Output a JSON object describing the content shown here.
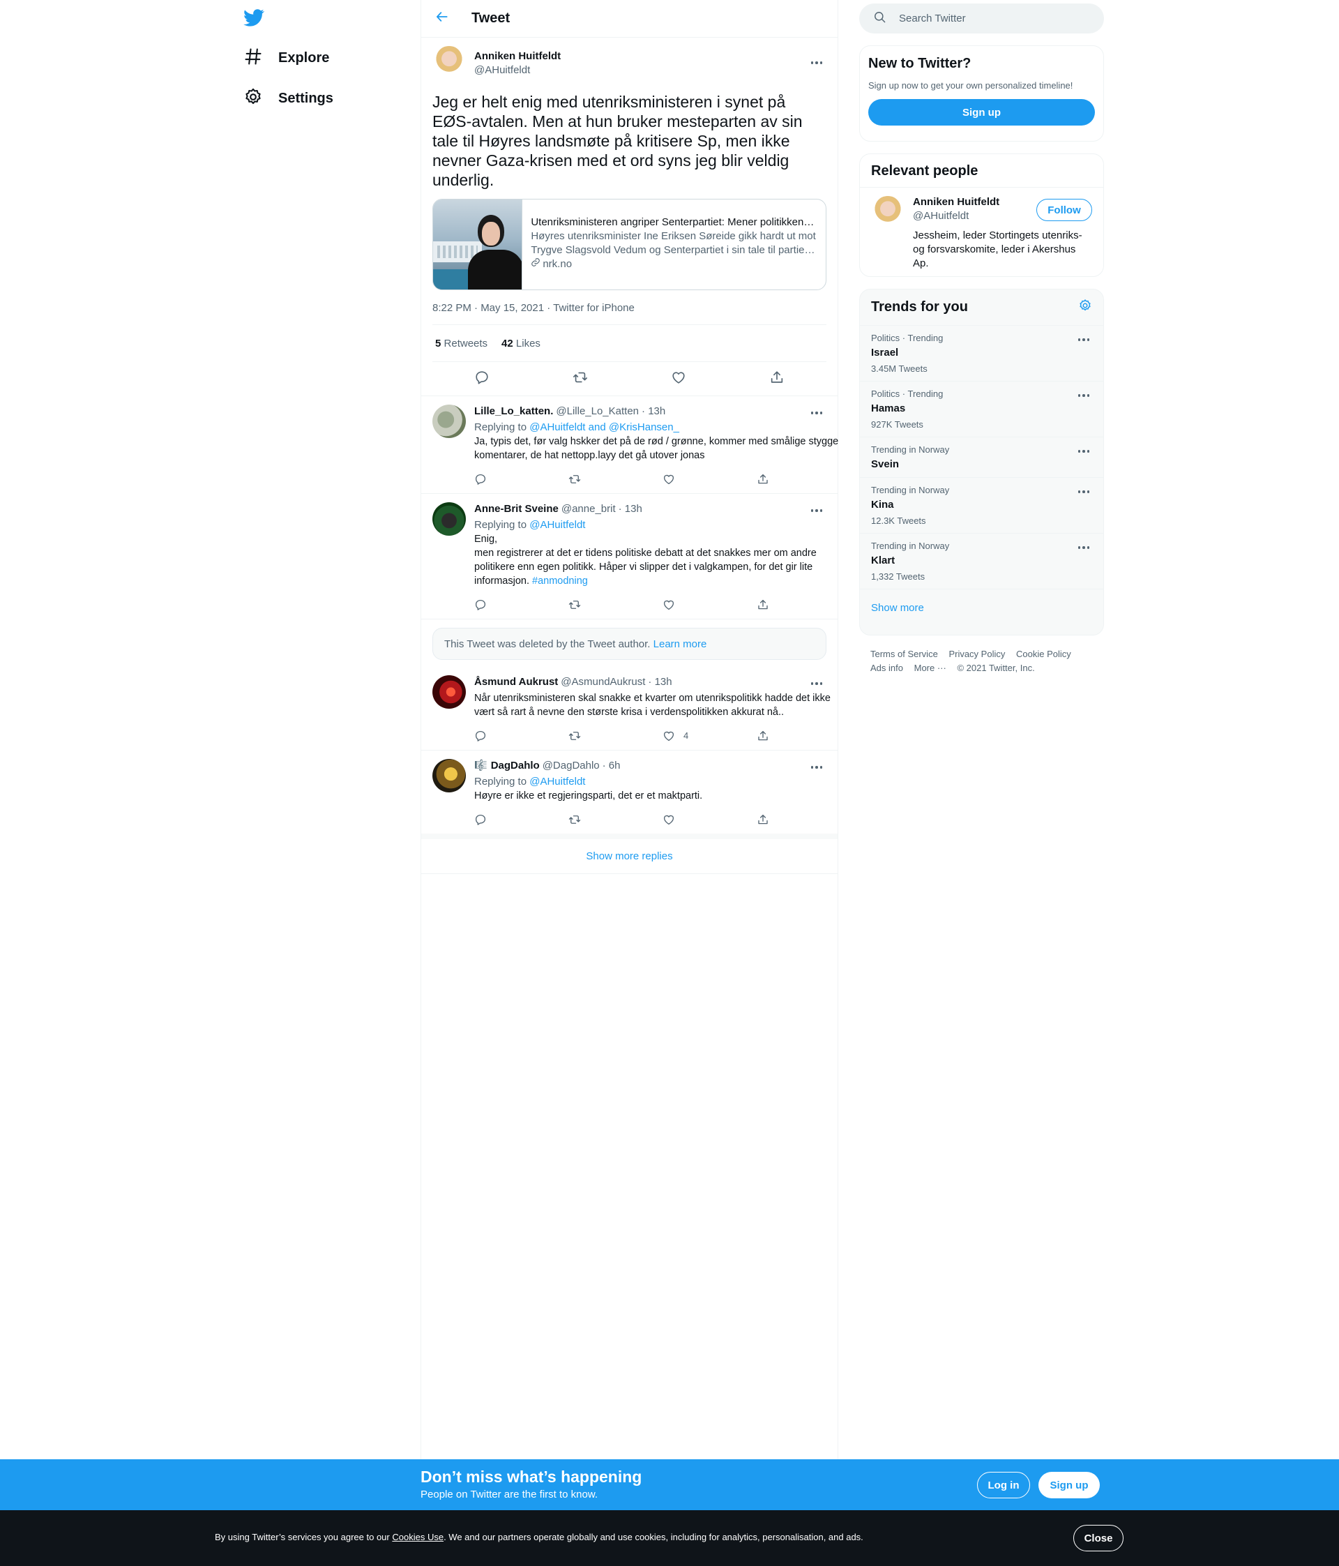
{
  "colors": {
    "accent": "#1d9bf0",
    "text": "#0f1419",
    "muted": "#536471",
    "border": "#eff3f4"
  },
  "nav": {
    "logo_icon": "twitter-bird-icon",
    "items": [
      {
        "label": "Explore",
        "icon": "hashtag-icon"
      },
      {
        "label": "Settings",
        "icon": "gear-icon"
      }
    ]
  },
  "header": {
    "title": "Tweet",
    "back_icon": "arrow-left-icon"
  },
  "tweet": {
    "author_name": "Anniken Huitfeldt",
    "author_handle": "@AHuitfeldt",
    "text": "Jeg er helt enig med utenriksministeren i synet på EØS-avtalen. Men at hun bruker mesteparten av sin tale til Høyres landsmøte på kritisere Sp, men ikke nevner Gaza-krisen med et ord syns jeg blir veldig underlig.",
    "card": {
      "title": "Utenriksministeren angriper Senterpartiet: Mener politikken…",
      "description": "Høyres utenriksminister Ine Eriksen Søreide gikk hardt ut mot Trygve Slagsvold Vedum og Senterpartiet i sin tale til partie…",
      "domain": "nrk.no"
    },
    "meta": "8:22 PM · May 15, 2021 · Twitter for iPhone",
    "retweets_count": "5",
    "retweets_label": "Retweets",
    "likes_count": "42",
    "likes_label": "Likes"
  },
  "replies": [
    {
      "name": "Lille_Lo_katten.",
      "handle": "@Lille_Lo_Katten",
      "time": "· 13h",
      "replying_prefix": "Replying to",
      "replying_to": "@AHuitfeldt and @KrisHansen_",
      "text": "Ja, typis det, før valg hskker det på de rød / grønne, kommer med smålige stygge komentarer, de hat nettopp.layy det gå utover jonas",
      "likes": ""
    },
    {
      "name": "Anne-Brit Sveine",
      "handle": "@anne_brit",
      "time": "· 13h",
      "replying_prefix": "Replying to",
      "replying_to": "@AHuitfeldt",
      "text_lines": [
        "Enig,",
        "men registrerer at det er tidens politiske debatt at det snakkes mer om andre politikere enn egen politikk. Håper vi slipper det i valgkampen, for det gir lite informasjon."
      ],
      "hashtag": "#anmodning",
      "likes": ""
    },
    {
      "name": "Åsmund Aukrust",
      "handle": "@AsmundAukrust",
      "time": "· 13h",
      "text": "Når utenriksministeren skal snakke et kvarter om utenrikspolitikk hadde det ikke vært så rart å nevne den største krisa i verdenspolitikken akkurat nå..",
      "likes": "4"
    },
    {
      "name": "DagDahlo",
      "name_prefix": "🎼",
      "handle": "@DagDahlo",
      "time": "· 6h",
      "replying_prefix": "Replying to",
      "replying_to": "@AHuitfeldt",
      "text": "Høyre er ikke et regjeringsparti, det er et maktparti.",
      "likes": ""
    }
  ],
  "deleted_notice": {
    "text": "This Tweet was deleted by the Tweet author.",
    "link": "Learn more"
  },
  "show_more_replies": "Show more replies",
  "search": {
    "placeholder": "Search Twitter"
  },
  "new_to_twitter": {
    "title": "New to Twitter?",
    "subtitle": "Sign up now to get your own personalized timeline!",
    "button": "Sign up"
  },
  "relevant_people": {
    "title": "Relevant people",
    "name": "Anniken Huitfeldt",
    "handle": "@AHuitfeldt",
    "bio": "Jessheim, leder Stortingets utenriks- og forsvarskomite, leder i Akershus Ap.",
    "follow": "Follow"
  },
  "trends": {
    "title": "Trends for you",
    "items": [
      {
        "context": "Politics · Trending",
        "name": "Israel",
        "count": "3.45M Tweets"
      },
      {
        "context": "Politics · Trending",
        "name": "Hamas",
        "count": "927K Tweets"
      },
      {
        "context": "Trending in Norway",
        "name": "Svein",
        "count": ""
      },
      {
        "context": "Trending in Norway",
        "name": "Kina",
        "count": "12.3K Tweets"
      },
      {
        "context": "Trending in Norway",
        "name": "Klart",
        "count": "1,332 Tweets"
      }
    ],
    "show_more": "Show more"
  },
  "footer": {
    "terms": "Terms of Service",
    "privacy": "Privacy Policy",
    "cookie": "Cookie Policy",
    "ads": "Ads info",
    "more": "More ···",
    "copyright": "© 2021 Twitter, Inc."
  },
  "bottom_bar": {
    "title": "Don’t miss what’s happening",
    "subtitle": "People on Twitter are the first to know.",
    "login": "Log in",
    "signup": "Sign up"
  },
  "cookie_bar": {
    "before": "By using Twitter’s services you agree to our ",
    "link": "Cookies Use",
    "after": ". We and our partners operate globally and use cookies, including for analytics, personalisation, and ads.",
    "close": "Close"
  }
}
